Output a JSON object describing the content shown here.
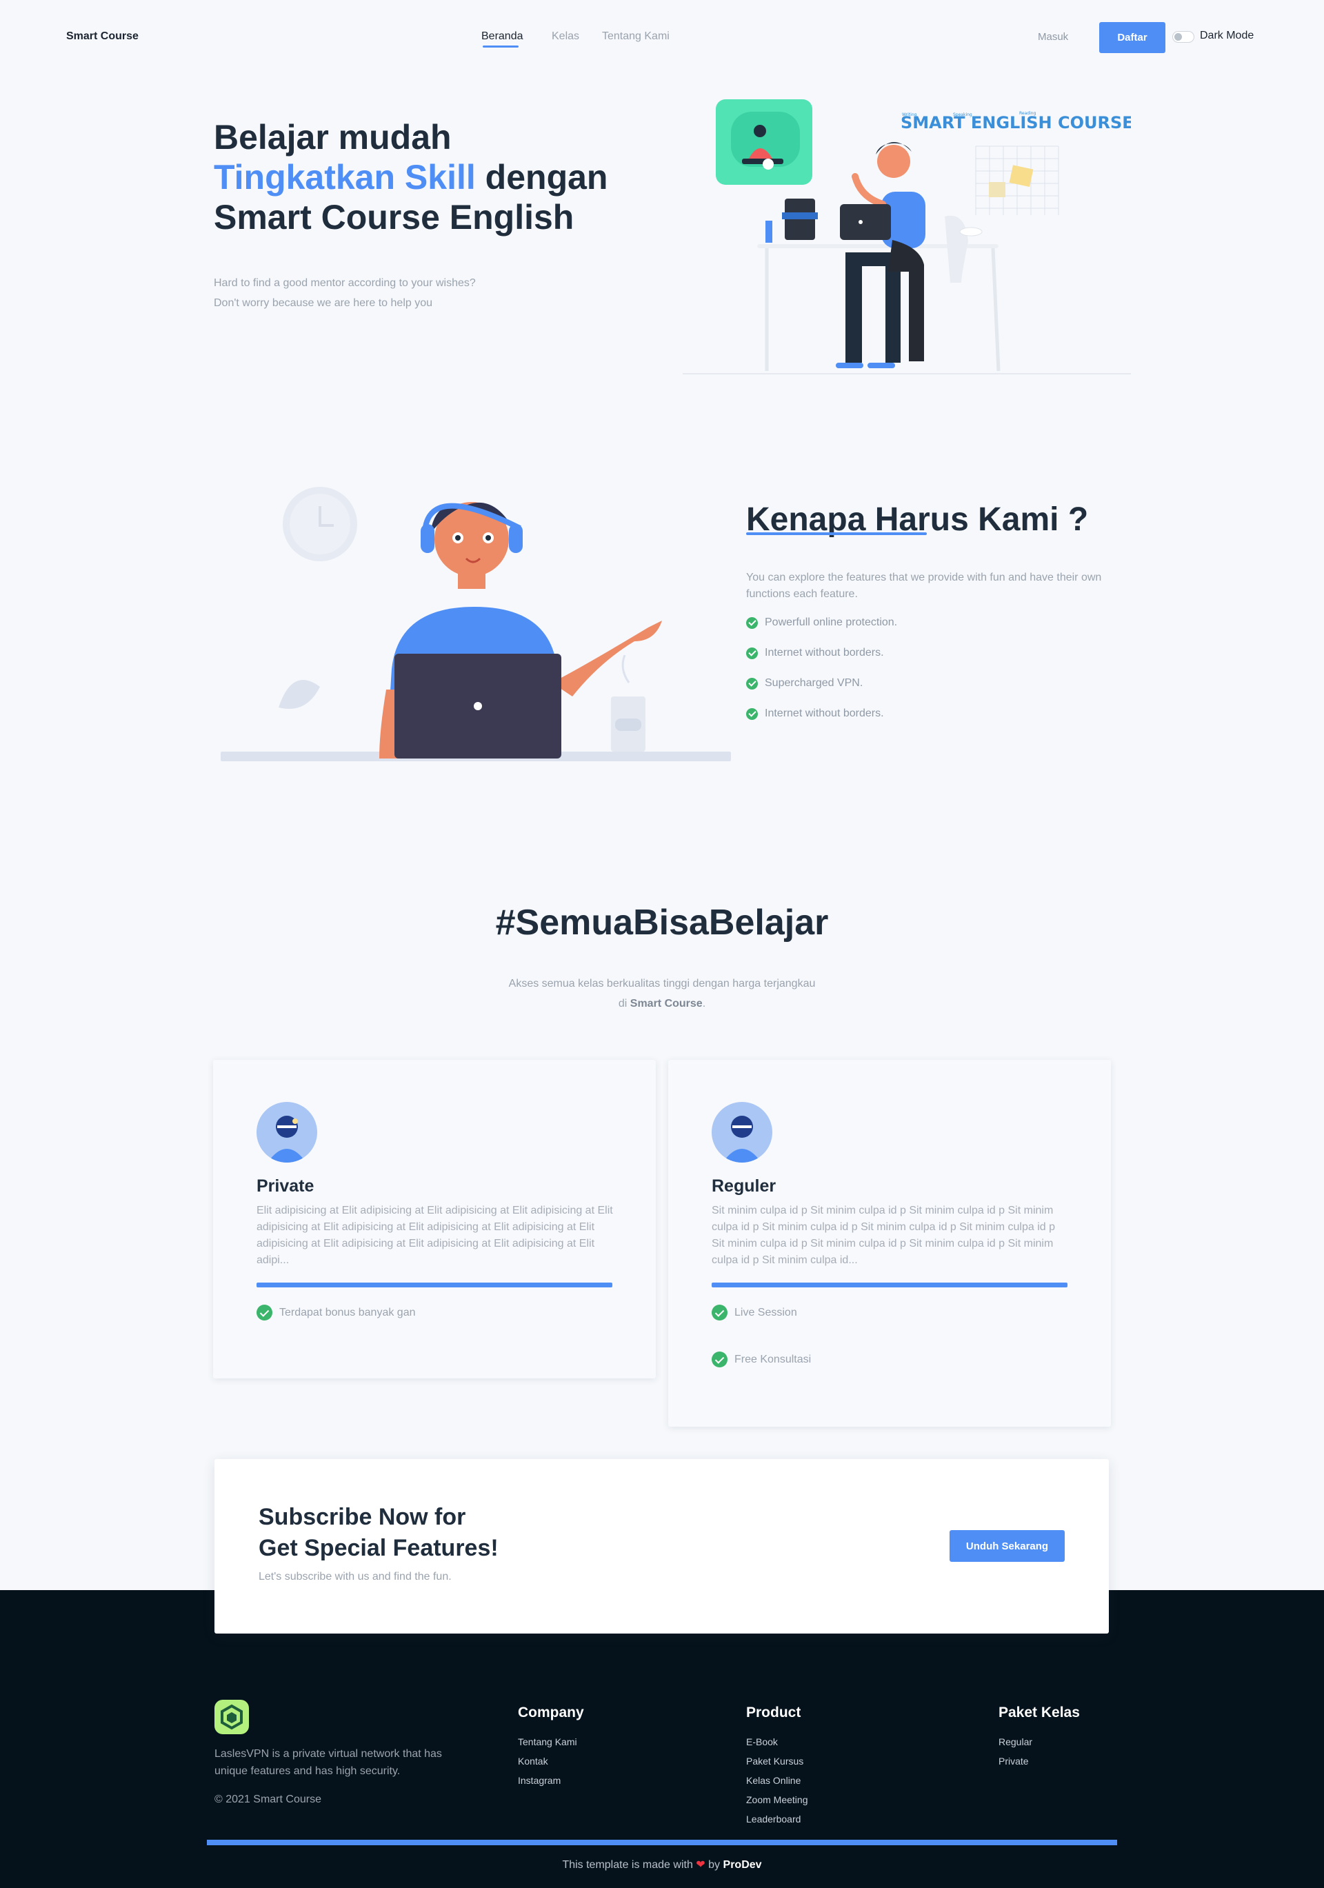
{
  "nav": {
    "brand": "Smart Course",
    "links": [
      "Beranda",
      "Kelas",
      "Tentang Kami"
    ],
    "login": "Masuk",
    "register": "Daftar",
    "dark_mode": "Dark Mode"
  },
  "hero": {
    "title_line1": "Belajar mudah",
    "title_highlight": "Tingkatkan Skill",
    "title_mid": "dengan",
    "title_line3": "Smart Course English",
    "subtitle_line1": "Hard to find a good mentor according to your wishes?",
    "subtitle_line2": "Don't worry because we are here to help you",
    "logo_text": "SMART ENGLISH COURSE",
    "logo_words": [
      "Writing",
      "Speaking",
      "Reading"
    ]
  },
  "why": {
    "title": "Kenapa Harus Kami ?",
    "description": "You can explore the features that we provide with fun and have their own functions each feature.",
    "features": [
      "Powerfull online protection.",
      "Internet without borders.",
      "Supercharged VPN.",
      "Internet without borders."
    ]
  },
  "semua": {
    "title": "#SemuaBisaBelajar",
    "subtitle_line1": "Akses semua kelas berkualitas tinggi dengan harga terjangkau",
    "subtitle_prefix": "di",
    "subtitle_brand": "Smart Course",
    "subtitle_suffix": "."
  },
  "plans": [
    {
      "title": "Private",
      "body": "Elit adipisicing at Elit adipisicing at Elit adipisicing at Elit adipisicing at Elit adipisicing at Elit adipisicing at Elit adipisicing at Elit adipisicing at Elit adipisicing at Elit adipisicing at Elit adipisicing at Elit adipisicing at Elit adipi...",
      "features": [
        "Terdapat bonus banyak gan"
      ]
    },
    {
      "title": "Reguler",
      "body": "Sit minim culpa id p Sit minim culpa id p Sit minim culpa id p Sit minim culpa id p Sit minim culpa id p Sit minim culpa id p Sit minim culpa id p Sit minim culpa id p Sit minim culpa id p Sit minim culpa id p Sit minim culpa id p Sit minim culpa id...",
      "features": [
        "Live Session",
        "Free Konsultasi"
      ]
    }
  ],
  "subscribe": {
    "title_line1": "Subscribe Now for",
    "title_line2": "Get Special Features!",
    "description": "Let's subscribe with us and find the fun.",
    "button": "Unduh Sekarang"
  },
  "footer": {
    "description": "LaslesVPN is a private virtual network that has unique features and has high security.",
    "copyright": "© 2021 Smart Course",
    "columns": [
      {
        "title": "Company",
        "links": [
          "Tentang Kami",
          "Kontak",
          "Instagram"
        ]
      },
      {
        "title": "Product",
        "links": [
          "E-Book",
          "Paket Kursus",
          "Kelas Online",
          "Zoom Meeting",
          "Leaderboard"
        ]
      },
      {
        "title": "Paket Kelas",
        "links": [
          "Regular",
          "Private"
        ]
      }
    ],
    "made_prefix": "This template is made with",
    "made_by": "by",
    "made_author": "ProDev"
  },
  "colors": {
    "accent": "#4f8ef5",
    "check": "#3bb56c",
    "footer_bg": "#06121b",
    "logo_bg": "#b4f07d"
  }
}
